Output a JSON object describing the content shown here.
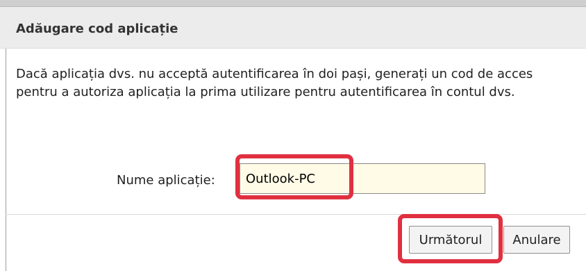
{
  "dialog": {
    "title": "Adăugare cod aplicație",
    "description": "Dacă aplicația dvs. nu acceptă autentificarea în doi pași, generați un cod de acces pentru a autoriza aplicația la prima utilizare pentru autentificarea în contul dvs.",
    "field": {
      "label": "Nume aplicație:",
      "value": "Outlook-PC"
    },
    "buttons": {
      "next_label": "Următorul",
      "cancel_label": "Anulare"
    }
  },
  "colors": {
    "highlight": "#e03040",
    "input_background": "#fffbe6",
    "title_bar": "#ececec"
  }
}
